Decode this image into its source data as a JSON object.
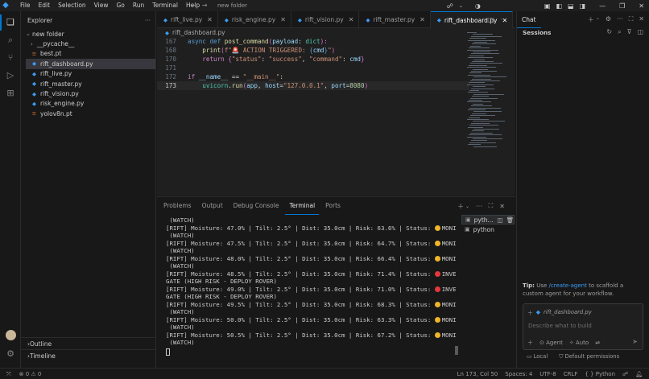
{
  "titlebar": {
    "menu": [
      "File",
      "Edit",
      "Selection",
      "View",
      "Go",
      "Run",
      "Terminal",
      "Help"
    ],
    "search": "new folder"
  },
  "explorer": {
    "title": "Explorer",
    "folder": "new folder",
    "items": [
      {
        "label": "__pycache__",
        "kind": "folder"
      },
      {
        "label": "best.pt",
        "kind": "pt"
      },
      {
        "label": "rift_dashboard.py",
        "kind": "py",
        "selected": true
      },
      {
        "label": "rift_live.py",
        "kind": "py"
      },
      {
        "label": "rift_master.py",
        "kind": "py"
      },
      {
        "label": "rift_vision.py",
        "kind": "py"
      },
      {
        "label": "risk_engine.py",
        "kind": "py"
      },
      {
        "label": "yolov8n.pt",
        "kind": "pt"
      }
    ],
    "outline": "Outline",
    "timeline": "Timeline"
  },
  "tabs": [
    {
      "label": "rift_live.py"
    },
    {
      "label": "risk_engine.py"
    },
    {
      "label": "rift_vision.py"
    },
    {
      "label": "rift_master.py"
    },
    {
      "label": "rift_dashboard.py",
      "active": true
    }
  ],
  "breadcrumb": "rift_dashboard.py",
  "code": {
    "line_numbers": [
      "167",
      "168",
      "169",
      "170",
      "171",
      "172",
      "173"
    ],
    "l167": {
      "t1": "async",
      "t2": "def",
      "t3": "post_command",
      "t4": "(",
      "t5": "payload",
      "t6": ": ",
      "t7": "dict",
      "t8": "):"
    },
    "l168": {
      "t1": "print",
      "t2": "(",
      "t3": "f\"🚨 ACTION TRIGGERED: ",
      "t4": "{",
      "t5": "cmd",
      "t6": "}",
      "t7": "\"",
      "t8": ")"
    },
    "l170": {
      "t1": "return",
      "t2": "{",
      "t3": "\"status\"",
      "t4": ": ",
      "t5": "\"success\"",
      "t6": ", ",
      "t7": "\"command\"",
      "t8": ": ",
      "t9": "cmd",
      "t10": "}"
    },
    "l172": {
      "t1": "if",
      "t2": "__name__",
      "t3": " == ",
      "t4": "\"__main__\"",
      "t5": ":"
    },
    "l173": {
      "t1": "uvicorn",
      "t2": ".",
      "t3": "run",
      "t4": "(",
      "t5": "app",
      "t6": ", ",
      "t7": "host",
      "t8": "=",
      "t9": "\"127.0.0.1\"",
      "t10": ", ",
      "t11": "port",
      "t12": "=",
      "t13": "8080",
      "t14": ")"
    }
  },
  "panel": {
    "tabs": [
      "Problems",
      "Output",
      "Debug Console",
      "Terminal",
      "Ports"
    ],
    "active_tab": "Terminal",
    "terminals": [
      "pyth...",
      "python"
    ]
  },
  "terminal_lines": [
    {
      "text": " (WATCH)"
    },
    {
      "text": "[RIFT] Moisture: 47.0% | Tilt: 2.5° | Dist: 35.0cm | Risk: 63.6% | Status: ",
      "dot": "#f0b429",
      "status": "MONITOR"
    },
    {
      "text": " (WATCH)"
    },
    {
      "text": "[RIFT] Moisture: 47.5% | Tilt: 2.5° | Dist: 35.0cm | Risk: 64.7% | Status: ",
      "dot": "#f0b429",
      "status": "MONITOR"
    },
    {
      "text": " (WATCH)"
    },
    {
      "text": "[RIFT] Moisture: 48.0% | Tilt: 2.5° | Dist: 35.0cm | Risk: 66.4% | Status: ",
      "dot": "#f0b429",
      "status": "MONITOR"
    },
    {
      "text": " (WATCH)"
    },
    {
      "text": "[RIFT] Moisture: 48.5% | Tilt: 2.5° | Dist: 35.0cm | Risk: 71.4% | Status: ",
      "dot": "#e5383b",
      "status": "INVESTI"
    },
    {
      "text": "GATE (HIGH RISK - DEPLOY ROVER)"
    },
    {
      "text": "[RIFT] Moisture: 49.0% | Tilt: 2.5° | Dist: 35.0cm | Risk: 71.0% | Status: ",
      "dot": "#e5383b",
      "status": "INVESTI"
    },
    {
      "text": "GATE (HIGH RISK - DEPLOY ROVER)"
    },
    {
      "text": "[RIFT] Moisture: 49.5% | Tilt: 2.5° | Dist: 35.0cm | Risk: 68.3% | Status: ",
      "dot": "#f0b429",
      "status": "MONITOR"
    },
    {
      "text": " (WATCH)"
    },
    {
      "text": "[RIFT] Moisture: 50.0% | Tilt: 2.5° | Dist: 35.0cm | Risk: 63.3% | Status: ",
      "dot": "#f0b429",
      "status": "MONITOR"
    },
    {
      "text": " (WATCH)"
    },
    {
      "text": "[RIFT] Moisture: 50.5% | Tilt: 2.5° | Dist: 35.0cm | Risk: 67.2% | Status: ",
      "dot": "#f0b429",
      "status": "MONITOR"
    },
    {
      "text": " (WATCH)"
    }
  ],
  "chat": {
    "title": "Chat",
    "sessions": "Sessions",
    "tip_bold": "Tip:",
    "tip_pre": " Use ",
    "tip_link": "/create-agent",
    "tip_post": " to scaffold a custom agent for your workflow.",
    "context_file": "rift_dashboard.py",
    "placeholder": "Describe what to build",
    "agent": "Agent",
    "auto": "Auto",
    "local": "Local",
    "approvals": "Default permissions"
  },
  "status": {
    "errors": "0",
    "warnings": "0",
    "position": "Ln 173, Col 50",
    "spaces": "Spaces: 4",
    "encoding": "UTF-8",
    "eol": "CRLF",
    "language": "Python",
    "lang_braces": "{ }"
  },
  "colors": {
    "accent": "#0078d4",
    "python_icon": "#3b9cf5",
    "pt_icon": "#e37933"
  }
}
